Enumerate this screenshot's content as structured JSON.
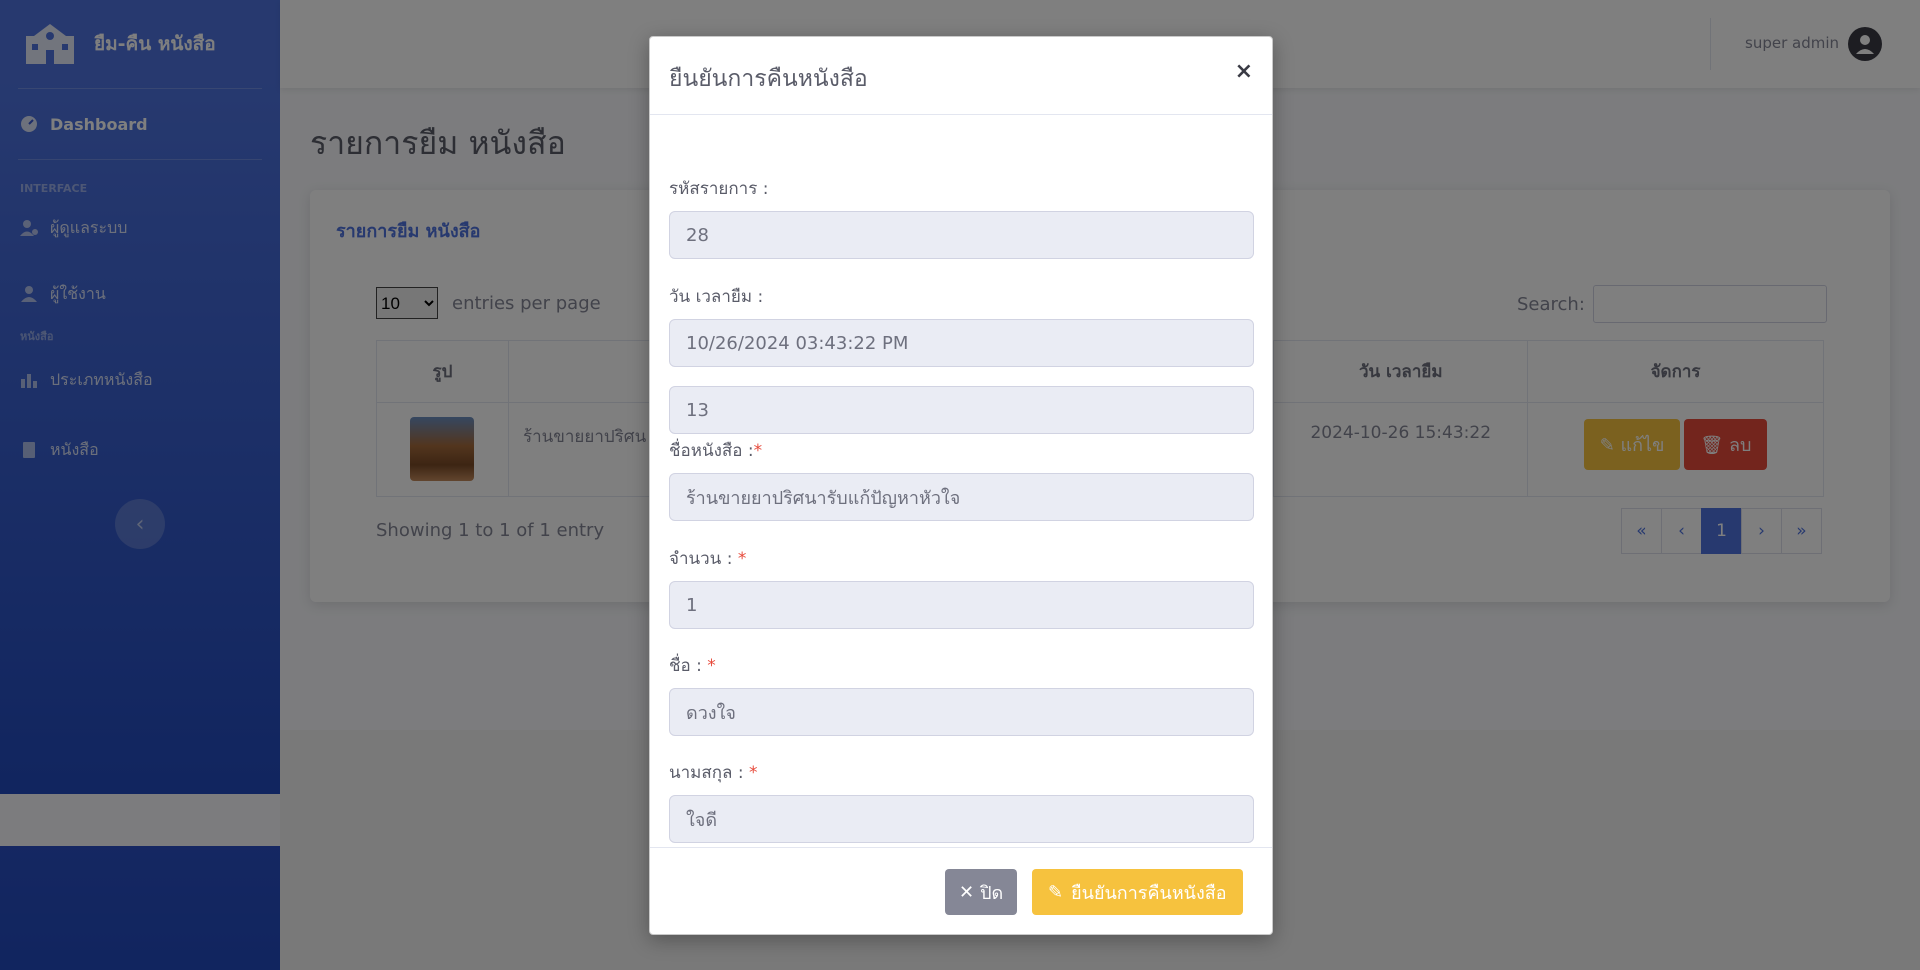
{
  "sidebar": {
    "brand": "ยืม-คืน หนังสือ",
    "dashboard": "Dashboard",
    "heading_interface": "INTERFACE",
    "item_admin": "ผู้ดูแลระบบ",
    "item_user": "ผู้ใช้งาน",
    "heading_books": "หนังสือ",
    "item_book_type": "ประเภทหนังสือ",
    "item_books": "หนังสือ",
    "toggle_icon": "chevron-left-icon"
  },
  "topbar": {
    "user_name": "super admin"
  },
  "page": {
    "title": "รายการยืม หนังสือ",
    "card_title": "รายการยืม หนังสือ",
    "entries_value": "10",
    "entries_label": "entries per page",
    "search_label": "Search:",
    "columns": {
      "image": "รูป",
      "borrow_time": "วัน เวลายืม",
      "manage": "จัดการ"
    },
    "row": {
      "book_name": "ร้านขายยาปริศน",
      "borrow_time": "2024-10-26 15:43:22",
      "edit": "แก้ไข",
      "delete": "ลบ"
    },
    "showing": "Showing 1 to 1 of 1 entry",
    "pager": [
      "«",
      "‹",
      "1",
      "›",
      "»"
    ]
  },
  "modal": {
    "title": "ยืนยันการคืนหนังสือ",
    "close_x": "×",
    "label_code": "รหัสรายการ :",
    "value_code": "28",
    "label_datetime": "วัน เวลายืม :",
    "value_datetime": "10/26/2024 03:43:22 PM",
    "value_book_id": "13",
    "label_book_name": "ชื่อหนังสือ :",
    "value_book_name": "ร้านขายยาปริศนารับแก้ปัญหาหัวใจ",
    "label_qty": "จำนวน : ",
    "value_qty": "1",
    "label_first_name": "ชื่อ : ",
    "value_first_name": "ดวงใจ",
    "label_last_name": "นามสกุล : ",
    "value_last_name": "ใจดี",
    "required_mark": "*",
    "btn_close": "ปิด",
    "btn_confirm": "ยืนยันการคืนหนังสือ"
  },
  "colors": {
    "primary": "#4e73df",
    "warning": "#f6c23e",
    "danger": "#e74a3b",
    "secondary": "#858796"
  }
}
